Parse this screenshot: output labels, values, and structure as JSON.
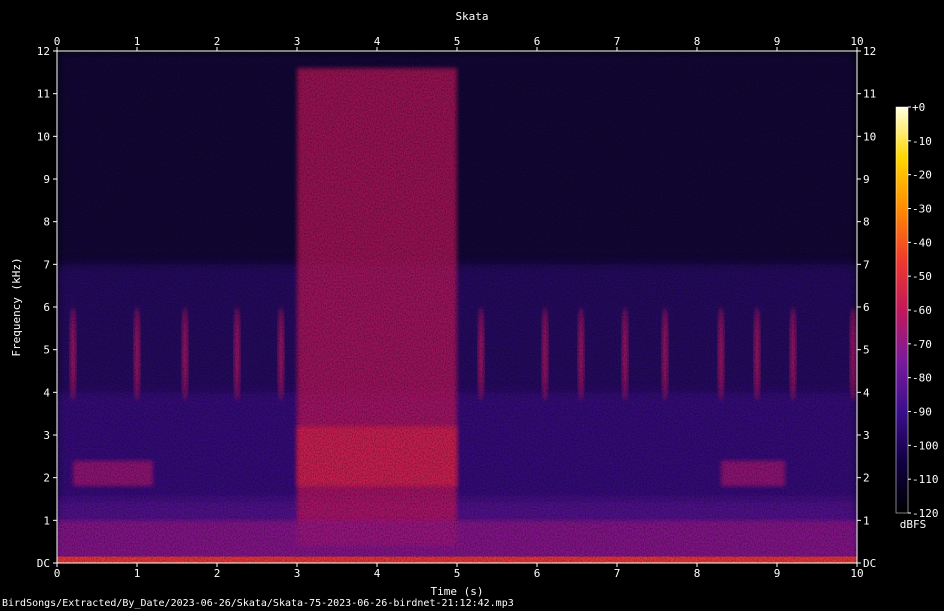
{
  "chart_data": {
    "type": "heatmap",
    "title": "Skata",
    "xlabel": "Time (s)",
    "ylabel": "Frequency (kHz)",
    "xlim": [
      0,
      10
    ],
    "ylim": [
      0,
      12
    ],
    "x_ticks": [
      "0",
      "1",
      "2",
      "3",
      "4",
      "5",
      "6",
      "7",
      "8",
      "9",
      "10"
    ],
    "y_ticks": [
      "DC",
      "1",
      "2",
      "3",
      "4",
      "5",
      "6",
      "7",
      "8",
      "9",
      "10",
      "11",
      "12"
    ],
    "colorbar": {
      "label": "dBFS",
      "range": [
        -120,
        0
      ],
      "ticks": [
        "+0",
        "-10",
        "-20",
        "-30",
        "-40",
        "-50",
        "-60",
        "-70",
        "-80",
        "-90",
        "-100",
        "-110",
        "-120"
      ],
      "colormap": [
        "#000000",
        "#100040",
        "#3b0f8c",
        "#7a1a9c",
        "#c2185b",
        "#ef3b2c",
        "#ff8c00",
        "#ffd700",
        "#ffffe0"
      ]
    },
    "features": [
      {
        "name": "broadband noise burst",
        "t_start": 3.0,
        "t_end": 5.0,
        "f_low": 0.4,
        "f_high": 11.6,
        "level_dbfs": -60
      },
      {
        "name": "low-frequency band",
        "t_start": 0,
        "t_end": 10,
        "f_low": 0,
        "f_high": 1.0,
        "level_dbfs": -70
      },
      {
        "name": "harmonic band 2 kHz",
        "t_start": 0.2,
        "t_end": 1.2,
        "f_low": 1.8,
        "f_high": 2.4,
        "level_dbfs": -65
      },
      {
        "name": "harmonic band 2 kHz",
        "t_start": 8.3,
        "t_end": 9.1,
        "f_low": 1.8,
        "f_high": 2.4,
        "level_dbfs": -65
      }
    ],
    "calls": [
      0.2,
      1.0,
      1.6,
      2.25,
      2.8,
      5.3,
      6.1,
      6.55,
      7.1,
      7.6,
      8.3,
      8.75,
      9.2,
      9.95
    ],
    "call_band_khz": [
      3.8,
      6.0
    ]
  },
  "footer_text": "BirdSongs/Extracted/By_Date/2023-06-26/Skata/Skata-75-2023-06-26-birdnet-21:12:42.mp3"
}
